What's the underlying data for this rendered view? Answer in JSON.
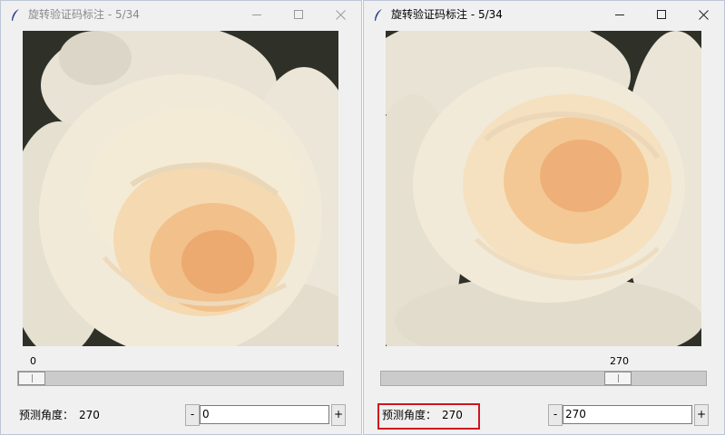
{
  "windows": [
    {
      "title": "旋转验证码标注 - 5/34",
      "slider_angle": "0",
      "slider_fraction": 0.0,
      "predicted_label": "预测角度：",
      "predicted_value": "270",
      "input_value": "0",
      "minus_label": "-",
      "plus_label": "+",
      "active": false,
      "highlighted": false
    },
    {
      "title": "旋转验证码标注 - 5/34",
      "slider_angle": "270",
      "slider_fraction": 0.75,
      "predicted_label": "预测角度：",
      "predicted_value": "270",
      "input_value": "270",
      "minus_label": "-",
      "plus_label": "+",
      "active": true,
      "highlighted": true
    }
  ],
  "colors": {
    "highlight_border": "#d0161d",
    "rose_petal": "#f3e6cf",
    "rose_center": "#f0b880"
  },
  "icons": [
    "feather-icon",
    "minimize-icon",
    "maximize-icon",
    "close-icon"
  ]
}
